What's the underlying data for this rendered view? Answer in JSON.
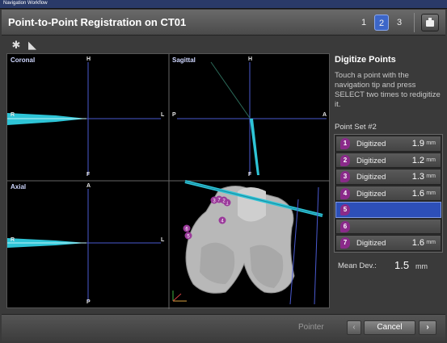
{
  "window": {
    "title": "Navigation Workflow"
  },
  "header": {
    "title": "Point-to-Point Registration on CT01",
    "steps": [
      "1",
      "2",
      "3"
    ],
    "active_step": "2",
    "camera_icon": "camera-icon"
  },
  "toolbar": {
    "icons": [
      "settings-gear-icon",
      "pointer-tool-icon"
    ]
  },
  "viewer": {
    "views": {
      "coronal": {
        "label": "Coronal",
        "top": "H",
        "bottom": "F",
        "left": "R",
        "right": "L"
      },
      "sagittal": {
        "label": "Sagittal",
        "top": "H",
        "bottom": "F",
        "left": "P",
        "right": "A"
      },
      "axial": {
        "label": "Axial",
        "top": "A",
        "bottom": "P",
        "left": "R",
        "right": "L"
      }
    },
    "markers": [
      "1",
      "2",
      "3",
      "4",
      "5",
      "6",
      "7"
    ],
    "colors": {
      "instrument": "#2ec4d6",
      "marker": "#9b3a9b",
      "crosshair": "#4a5ad0"
    }
  },
  "panel": {
    "title": "Digitize Points",
    "instructions": "Touch a point with the navigation tip and press SELECT two times to redigitize it.",
    "set_label": "Point Set #2",
    "points": [
      {
        "num": "1",
        "status": "Digitized",
        "value": "1.9",
        "unit": "mm"
      },
      {
        "num": "2",
        "status": "Digitized",
        "value": "1.2",
        "unit": "mm"
      },
      {
        "num": "3",
        "status": "Digitized",
        "value": "1.3",
        "unit": "mm"
      },
      {
        "num": "4",
        "status": "Digitized",
        "value": "1.6",
        "unit": "mm"
      },
      {
        "num": "5",
        "status": "",
        "value": "",
        "unit": ""
      },
      {
        "num": "6",
        "status": "",
        "value": "",
        "unit": ""
      },
      {
        "num": "7",
        "status": "Digitized",
        "value": "1.6",
        "unit": "mm"
      }
    ],
    "selected_point": "5",
    "mean_label": "Mean Dev.:",
    "mean_value": "1.5",
    "mean_unit": "mm"
  },
  "footer": {
    "pointer_label": "Pointer",
    "prev_label": "‹",
    "cancel_label": "Cancel",
    "next_label": "›"
  }
}
